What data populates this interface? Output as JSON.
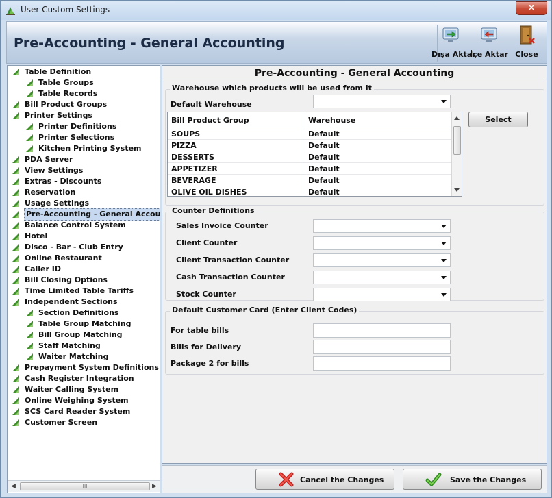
{
  "window": {
    "title": "User Custom Settings",
    "close_glyph": "✕"
  },
  "header": {
    "title": "Pre-Accounting - General Accounting",
    "buttons": [
      {
        "label": "Dışa Aktar",
        "icon": "export-icon"
      },
      {
        "label": "İçe Aktar",
        "icon": "import-icon"
      },
      {
        "label": "Close",
        "icon": "door-exit-icon"
      }
    ]
  },
  "sidebar": {
    "items": [
      {
        "label": "Table Definition",
        "level": 0
      },
      {
        "label": "Table Groups",
        "level": 1
      },
      {
        "label": "Table Records",
        "level": 1
      },
      {
        "label": "Bill Product Groups",
        "level": 0
      },
      {
        "label": "Printer Settings",
        "level": 0
      },
      {
        "label": "Printer Definitions",
        "level": 1
      },
      {
        "label": "Printer Selections",
        "level": 1
      },
      {
        "label": "Kitchen Printing System",
        "level": 1
      },
      {
        "label": "PDA Server",
        "level": 0
      },
      {
        "label": "View Settings",
        "level": 0
      },
      {
        "label": "Extras - Discounts",
        "level": 0
      },
      {
        "label": "Reservation",
        "level": 0
      },
      {
        "label": "Usage Settings",
        "level": 0
      },
      {
        "label": "Pre-Accounting - General Accountin",
        "level": 0,
        "selected": true
      },
      {
        "label": "Balance Control System",
        "level": 0
      },
      {
        "label": "Hotel",
        "level": 0
      },
      {
        "label": "Disco - Bar - Club Entry",
        "level": 0
      },
      {
        "label": "Online Restaurant",
        "level": 0
      },
      {
        "label": "Caller ID",
        "level": 0
      },
      {
        "label": "Bill Closing Options",
        "level": 0
      },
      {
        "label": "Time Limited Table Tariffs",
        "level": 0
      },
      {
        "label": "Independent Sections",
        "level": 0
      },
      {
        "label": "Section Definitions",
        "level": 1
      },
      {
        "label": "Table Group Matching",
        "level": 1
      },
      {
        "label": "Bill Group Matching",
        "level": 1
      },
      {
        "label": "Staff Matching",
        "level": 1
      },
      {
        "label": "Waiter Matching",
        "level": 1
      },
      {
        "label": "Prepayment System Definitions",
        "level": 0
      },
      {
        "label": "Cash Register Integration",
        "level": 0
      },
      {
        "label": "Waiter Calling System",
        "level": 0
      },
      {
        "label": "Online Weighing System",
        "level": 0
      },
      {
        "label": "SCS Card Reader System",
        "level": 0
      },
      {
        "label": "Customer Screen",
        "level": 0
      }
    ],
    "scroll_grip": "III"
  },
  "content": {
    "title": "Pre-Accounting - General Accounting",
    "warehouse_group": {
      "title": "Warehouse which products will be used from it",
      "default_label": "Default Warehouse",
      "default_value": "",
      "select_button": "Select",
      "columns": [
        "Bill Product Group",
        "Warehouse"
      ],
      "rows": [
        [
          "SOUPS",
          "Default"
        ],
        [
          "PIZZA",
          "Default"
        ],
        [
          "DESSERTS",
          "Default"
        ],
        [
          "APPETIZER",
          "Default"
        ],
        [
          "BEVERAGE",
          "Default"
        ],
        [
          "OLIVE OIL DISHES",
          "Default"
        ]
      ]
    },
    "counter_group": {
      "title": "Counter Definitions",
      "fields": [
        {
          "label": "Sales Invoice Counter",
          "value": ""
        },
        {
          "label": "Client Counter",
          "value": ""
        },
        {
          "label": "Client Transaction Counter",
          "value": ""
        },
        {
          "label": "Cash Transaction Counter",
          "value": ""
        },
        {
          "label": "Stock Counter",
          "value": ""
        }
      ]
    },
    "customer_group": {
      "title": "Default Customer Card (Enter Client Codes)",
      "fields": [
        {
          "label": "For table bills",
          "value": ""
        },
        {
          "label": "Bills for Delivery",
          "value": ""
        },
        {
          "label": "Package 2 for bills",
          "value": ""
        }
      ]
    }
  },
  "footer": {
    "cancel_label": "Cancel the Changes",
    "save_label": "Save the Changes"
  },
  "colors": {
    "accent_header_text": "#1d2c45",
    "tree_icon": "#3f8f2a",
    "selected_bg": "#c6d9f0"
  }
}
